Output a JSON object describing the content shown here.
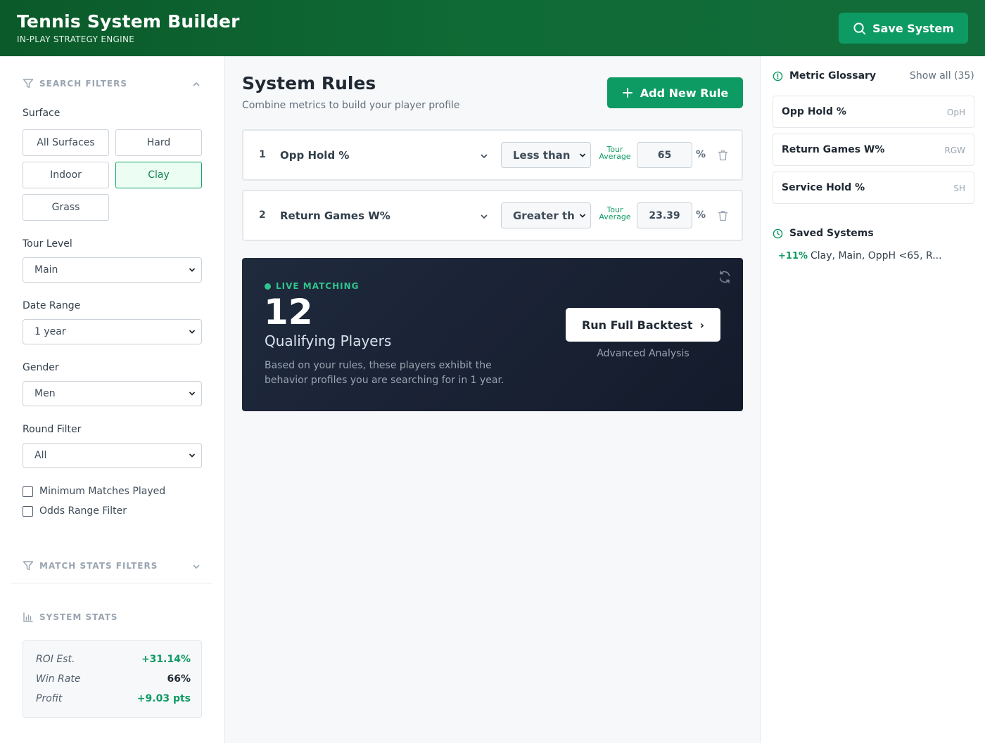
{
  "header": {
    "title": "Tennis System Builder",
    "subtitle": "IN-PLAY STRATEGY ENGINE",
    "save_label": "Save System"
  },
  "sidebar": {
    "search_filters_title": "SEARCH FILTERS",
    "surface_label": "Surface",
    "surfaces": [
      "All Surfaces",
      "Hard",
      "Indoor",
      "Clay",
      "Grass"
    ],
    "active_surface": "Clay",
    "tour_level_label": "Tour Level",
    "tour_level_value": "Main",
    "date_range_label": "Date Range",
    "date_range_value": "1 year",
    "gender_label": "Gender",
    "gender_value": "Men",
    "round_filter_label": "Round Filter",
    "round_filter_value": "All",
    "checkboxes": [
      "Minimum Matches Played",
      "Odds Range Filter"
    ],
    "match_stats_title": "MATCH STATS FILTERS",
    "system_stats_title": "SYSTEM STATS",
    "stats": [
      {
        "label": "ROI Est.",
        "value": "+31.14%"
      },
      {
        "label": "Win Rate",
        "value": "66%"
      },
      {
        "label": "Profit",
        "value": "+9.03 pts"
      }
    ]
  },
  "main": {
    "title": "System Rules",
    "subtitle": "Combine metrics to build your player profile",
    "add_rule_label": "Add New Rule",
    "tour_avg_line1": "Tour",
    "tour_avg_line2": "Average",
    "rules": [
      {
        "num": "1",
        "metric": "Opp Hold %",
        "operator": "Less than",
        "value": "65",
        "unit": "%"
      },
      {
        "num": "2",
        "metric": "Return Games W%",
        "operator": "Greater th",
        "value": "23.39",
        "unit": "%"
      }
    ],
    "live": {
      "tag": "LIVE MATCHING",
      "count": "12",
      "label": "Qualifying Players",
      "description": "Based on your rules, these players exhibit the behavior profiles you are searching for in 1 year.",
      "run_label": "Run Full Backtest",
      "run_arrow": "›",
      "advanced": "Advanced Analysis"
    }
  },
  "right": {
    "glossary_title": "Metric Glossary",
    "show_all": "Show all (35)",
    "glossary": [
      {
        "name": "Opp Hold %",
        "abbr": "OpH"
      },
      {
        "name": "Return Games W%",
        "abbr": "RGW"
      },
      {
        "name": "Service Hold %",
        "abbr": "SH"
      }
    ],
    "saved_title": "Saved Systems",
    "saved": [
      {
        "pct": "+11%",
        "text": "Clay, Main, OppH <65, R..."
      }
    ]
  },
  "colors": {
    "brand_green": "#0d9b63",
    "header_green": "#0f6b35",
    "live_bg": "#1a2233",
    "live_accent": "#30c48d"
  }
}
